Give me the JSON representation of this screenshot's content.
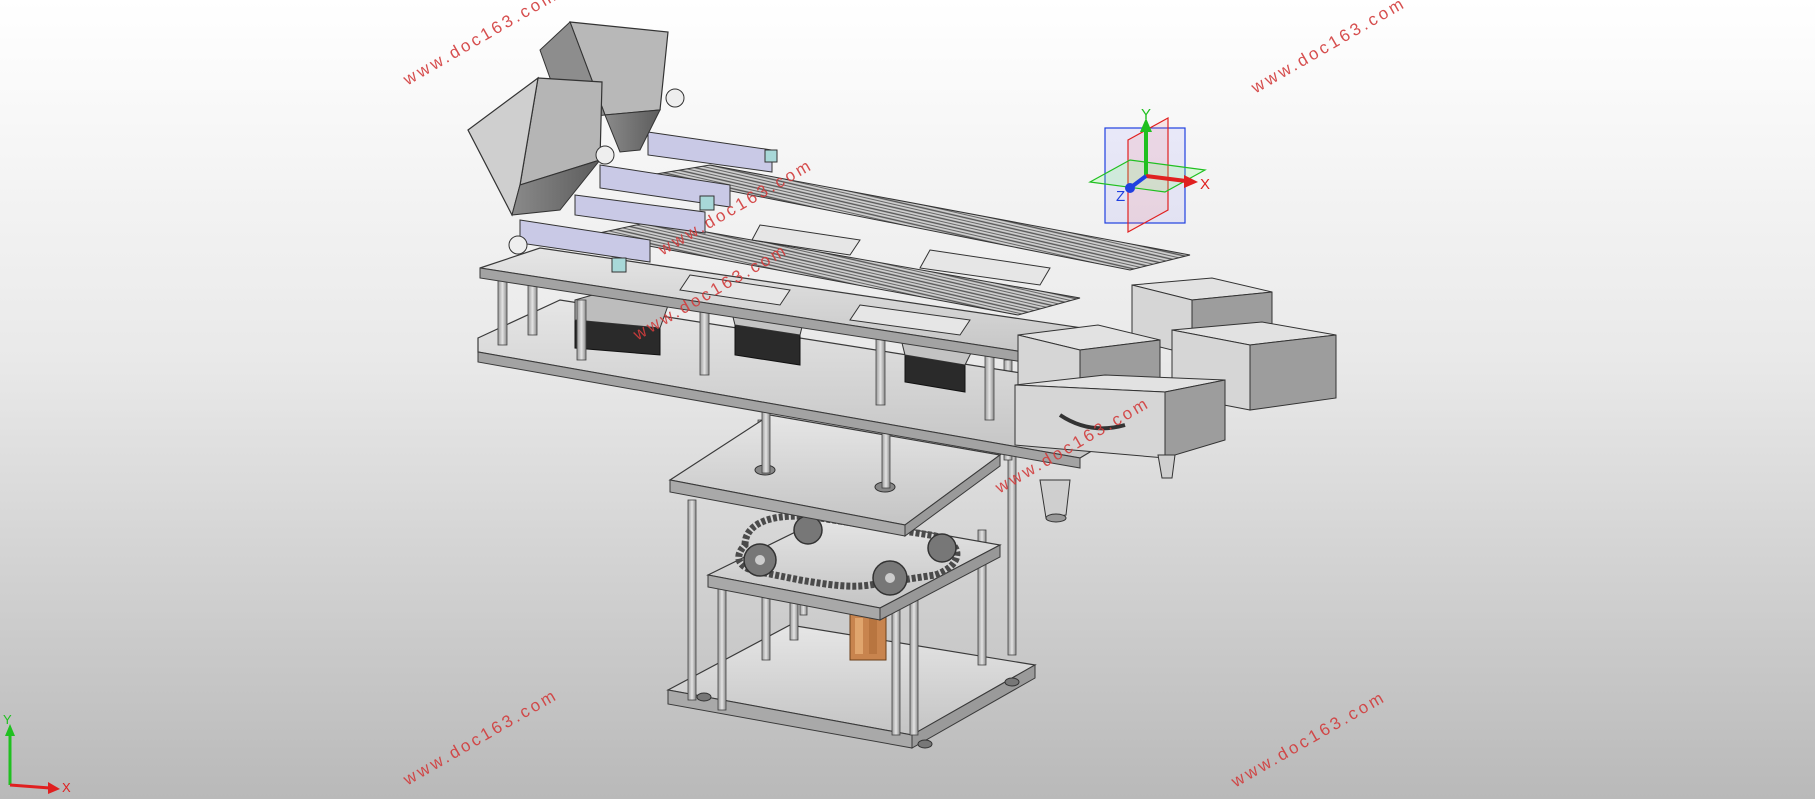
{
  "watermarks": [
    "www.doc163.com",
    "www.doc163.com",
    "www.doc163.com",
    "www.doc163.com",
    "www.doc163.com",
    "www.doc163.com",
    "www.doc163.com"
  ],
  "triad": {
    "x": "X",
    "y": "Y",
    "z": "Z"
  },
  "corner_triad": {
    "x": "X",
    "y": "Y"
  },
  "colors": {
    "x_axis": "#e02020",
    "y_axis": "#20c020",
    "z_axis": "#2040e0",
    "watermark": "#d23c3c",
    "part_face": "#d9d9d9",
    "part_edge": "#3a3a3a"
  }
}
